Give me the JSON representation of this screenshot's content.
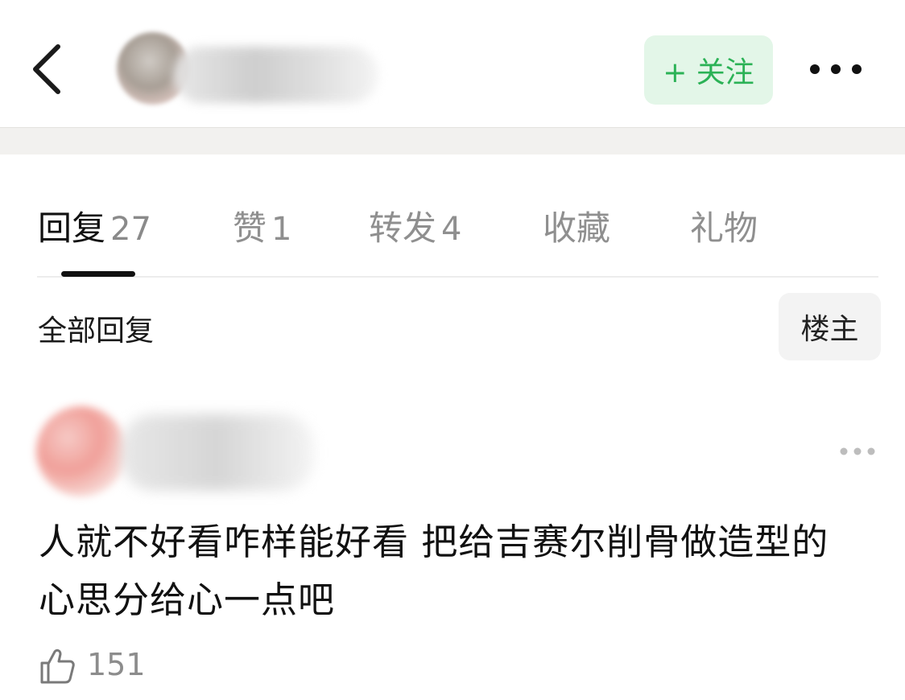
{
  "header": {
    "follow_label": "+ 关注"
  },
  "tabs": [
    {
      "label": "回复",
      "count": "27"
    },
    {
      "label": "赞",
      "count": "1"
    },
    {
      "label": "转发",
      "count": "4"
    },
    {
      "label": "收藏",
      "count": ""
    },
    {
      "label": "礼物",
      "count": ""
    }
  ],
  "filter": {
    "label": "全部回复",
    "owner_label": "楼主"
  },
  "comment": {
    "text_line1": "人就不好看咋样能好看 把给吉赛尔削骨做造型的",
    "text_line2": "心思分给心一点吧",
    "likes": "151"
  },
  "colors": {
    "follow_green": "#2bb256",
    "follow_bg": "#e3f6e8"
  },
  "icons": [
    "back-arrow-icon",
    "more-dots-icon",
    "thumbs-up-icon"
  ]
}
